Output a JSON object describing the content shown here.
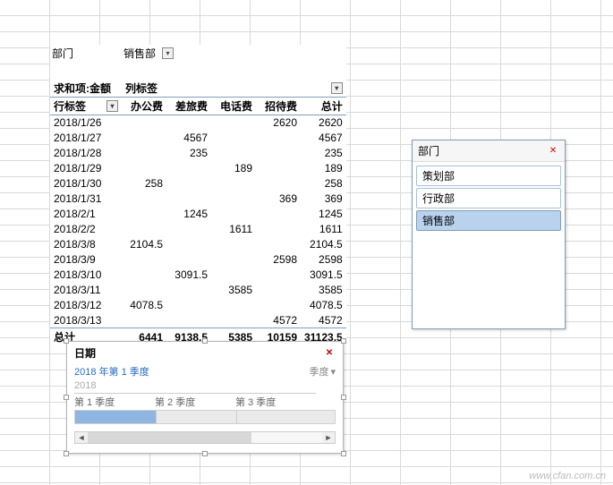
{
  "filter": {
    "label": "部门",
    "value": "销售部"
  },
  "pivot": {
    "value_label": "求和项:金额",
    "col_label": "列标签",
    "row_label": "行标签",
    "columns": [
      "办公费",
      "差旅费",
      "电话费",
      "招待费",
      "总计"
    ],
    "rows": [
      {
        "label": "2018/1/26",
        "vals": [
          "",
          "",
          "",
          "2620",
          "2620"
        ]
      },
      {
        "label": "2018/1/27",
        "vals": [
          "",
          "4567",
          "",
          "",
          "4567"
        ]
      },
      {
        "label": "2018/1/28",
        "vals": [
          "",
          "235",
          "",
          "",
          "235"
        ]
      },
      {
        "label": "2018/1/29",
        "vals": [
          "",
          "",
          "189",
          "",
          "189"
        ]
      },
      {
        "label": "2018/1/30",
        "vals": [
          "258",
          "",
          "",
          "",
          "258"
        ]
      },
      {
        "label": "2018/1/31",
        "vals": [
          "",
          "",
          "",
          "369",
          "369"
        ]
      },
      {
        "label": "2018/2/1",
        "vals": [
          "",
          "1245",
          "",
          "",
          "1245"
        ]
      },
      {
        "label": "2018/2/2",
        "vals": [
          "",
          "",
          "1611",
          "",
          "1611"
        ]
      },
      {
        "label": "2018/3/8",
        "vals": [
          "2104.5",
          "",
          "",
          "",
          "2104.5"
        ]
      },
      {
        "label": "2018/3/9",
        "vals": [
          "",
          "",
          "",
          "2598",
          "2598"
        ]
      },
      {
        "label": "2018/3/10",
        "vals": [
          "",
          "3091.5",
          "",
          "",
          "3091.5"
        ]
      },
      {
        "label": "2018/3/11",
        "vals": [
          "",
          "",
          "3585",
          "",
          "3585"
        ]
      },
      {
        "label": "2018/3/12",
        "vals": [
          "4078.5",
          "",
          "",
          "",
          "4078.5"
        ]
      },
      {
        "label": "2018/3/13",
        "vals": [
          "",
          "",
          "",
          "4572",
          "4572"
        ]
      }
    ],
    "total_label": "总计",
    "totals": [
      "6441",
      "9138.5",
      "5385",
      "10159",
      "31123.5"
    ]
  },
  "slicer_dept": {
    "title": "部门",
    "items": [
      "策划部",
      "行政部",
      "销售部"
    ],
    "selected": "销售部"
  },
  "timeline": {
    "title": "日期",
    "period_text": "2018 年第 1 季度",
    "level": "季度",
    "year": "2018",
    "quarters": [
      "第 1 季度",
      "第 2 季度",
      "第 3 季度"
    ]
  },
  "watermark": "www.cfan.com.cn"
}
